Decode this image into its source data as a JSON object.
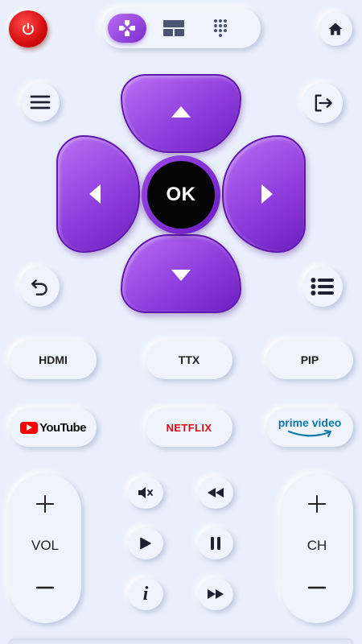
{
  "header": {
    "power_icon": "power-icon",
    "modes": [
      {
        "icon": "gamepad-icon",
        "active": true
      },
      {
        "icon": "layout-icon",
        "active": false
      },
      {
        "icon": "keypad-icon",
        "active": false
      }
    ],
    "home_icon": "home-icon"
  },
  "nav": {
    "menu_icon": "hamburger-icon",
    "exit_icon": "exit-icon",
    "back_icon": "back-icon",
    "list_icon": "list-icon",
    "ok_label": "OK"
  },
  "buttons": {
    "hdmi": "HDMI",
    "ttx": "TTX",
    "pip": "PIP"
  },
  "apps": {
    "youtube": "YouTube",
    "netflix": "NETFLIX",
    "prime": "prime video"
  },
  "rockers": {
    "vol_label": "VOL",
    "ch_label": "CH"
  },
  "media": {
    "info_glyph": "i"
  },
  "colors": {
    "accent": "#8f3fdd",
    "power": "#d40d0d",
    "background": "#eaf0fb",
    "youtube": "#ff0000",
    "netflix": "#e50914",
    "prime": "#0f79af"
  }
}
